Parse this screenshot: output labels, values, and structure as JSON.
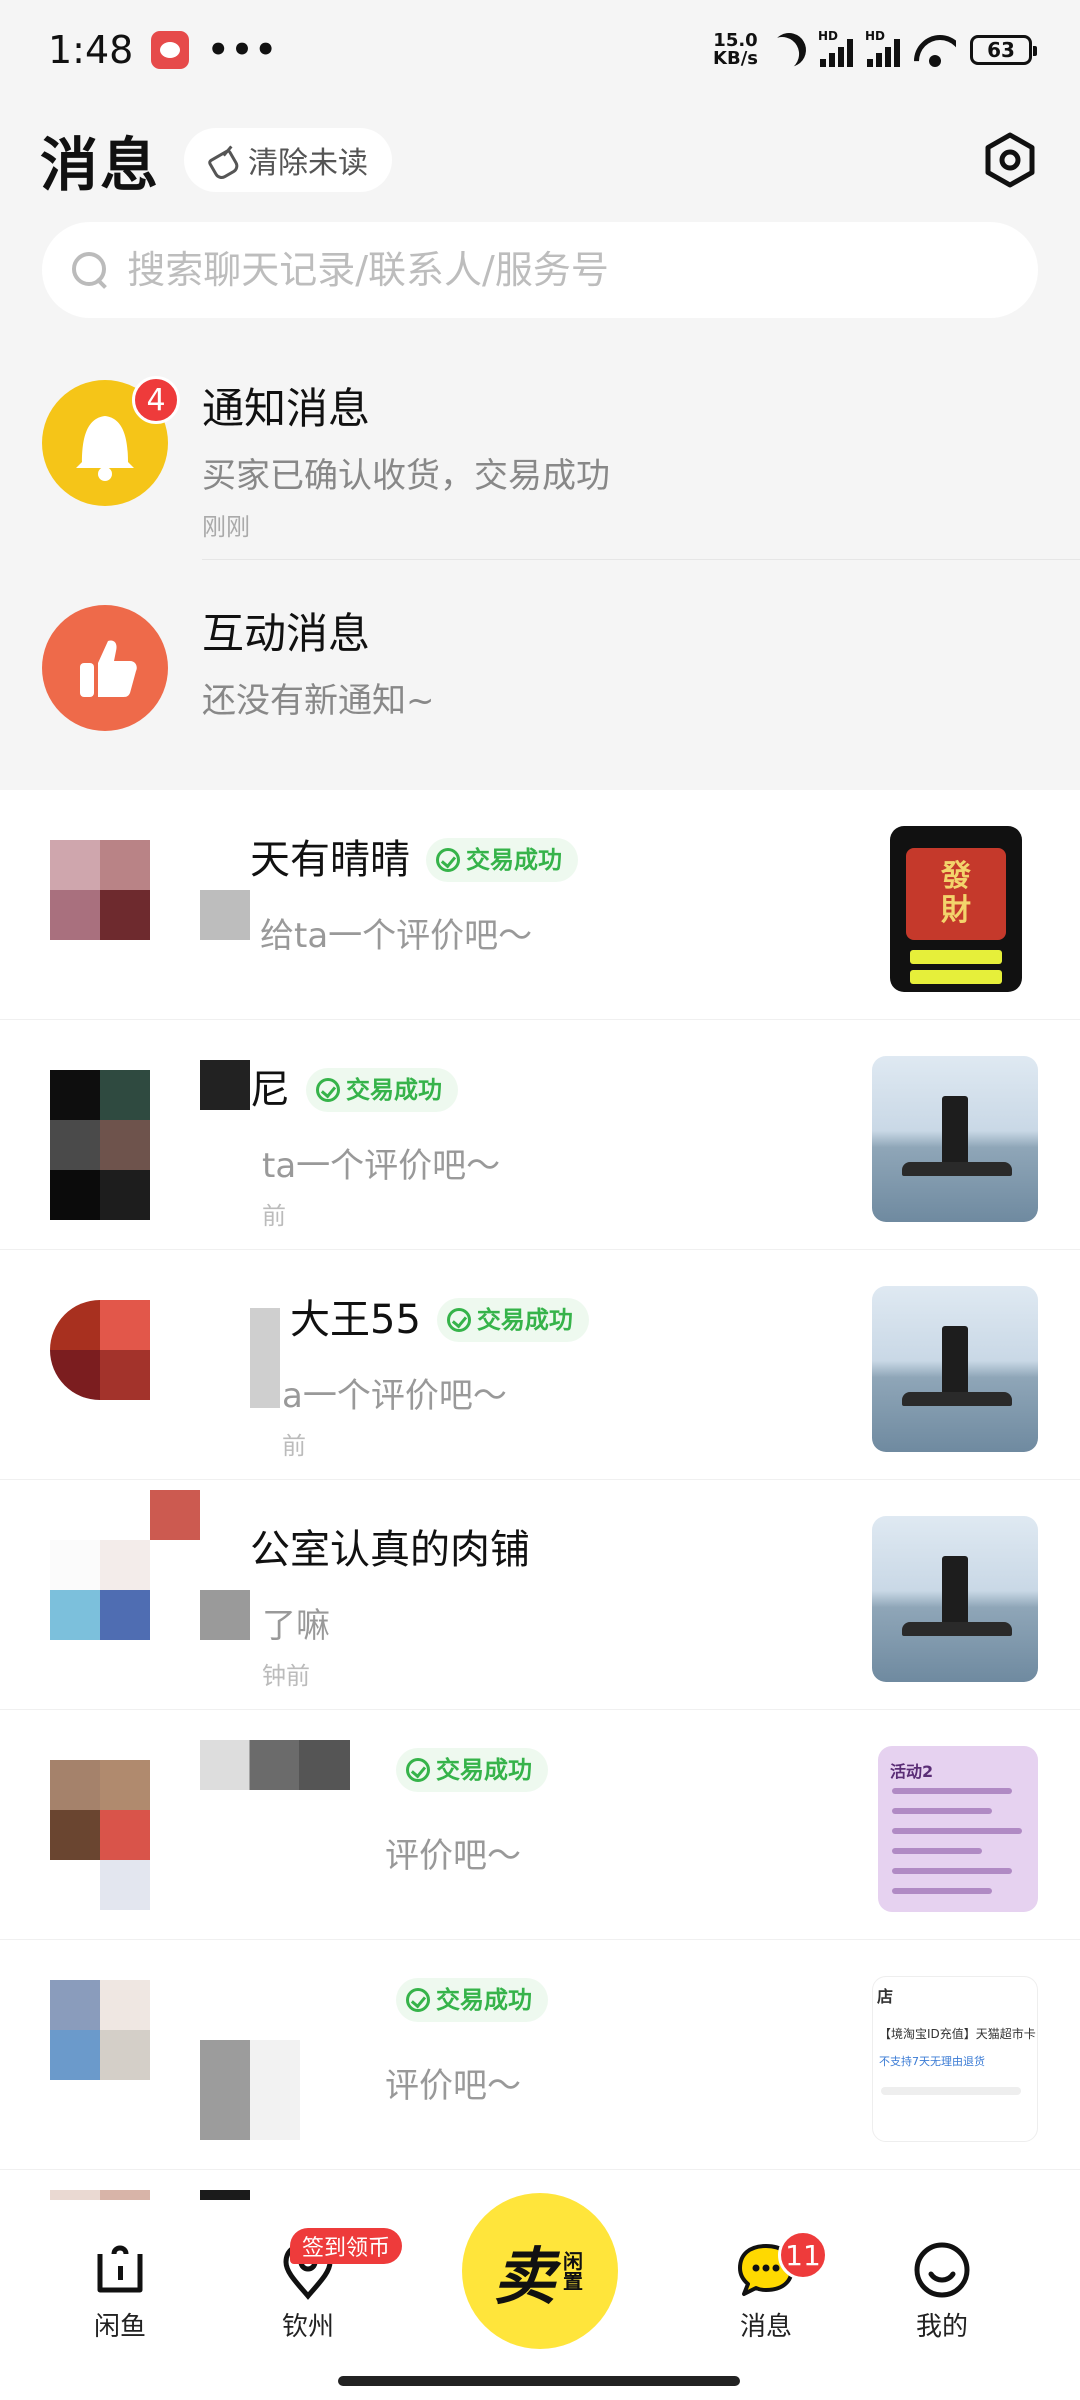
{
  "status_bar": {
    "time": "1:48",
    "dots": "•••",
    "net_speed_value": "15.0",
    "net_speed_unit": "KB/s",
    "hd1": "HD",
    "hd2": "HD",
    "battery": "63"
  },
  "header": {
    "title": "消息",
    "clear_unread": "清除未读"
  },
  "search": {
    "placeholder": "搜索聊天记录/联系人/服务号"
  },
  "system_messages": [
    {
      "title": "通知消息",
      "subtitle": "买家已确认收货，交易成功",
      "time": "刚刚",
      "badge": "4",
      "color": "#f5c518"
    },
    {
      "title": "互动消息",
      "subtitle": "还没有新通知~",
      "color": "#ee6a4a"
    }
  ],
  "chats": [
    {
      "name": "天有晴晴",
      "badge": "交易成功",
      "preview": "给ta一个评价吧～",
      "time": ""
    },
    {
      "name": "尼",
      "badge": "交易成功",
      "preview": "ta一个评价吧～",
      "time": "前"
    },
    {
      "name": "大王55",
      "badge": "交易成功",
      "preview": "a一个评价吧～",
      "time": "前"
    },
    {
      "name": "公室认真的肉铺",
      "badge": "",
      "preview": "了嘛",
      "time": "钟前"
    },
    {
      "name": "",
      "badge": "交易成功",
      "preview": "评价吧～",
      "time": ""
    },
    {
      "name": "",
      "badge": "交易成功",
      "preview": "评价吧～",
      "time": ""
    }
  ],
  "thumbnails": {
    "fortune_text_top": "發",
    "fortune_text_bottom": "財",
    "purple_title": "活动2",
    "shop_label": "店",
    "shop_item": "【境淘宝ID充值】天猫超市卡",
    "shop_sub": "不支持7天无理由退货"
  },
  "bottom_nav": {
    "home": "闲鱼",
    "location": "钦州",
    "checkin_badge": "签到领币",
    "sell_main": "卖",
    "sell_sub": "闲置",
    "messages": "消息",
    "messages_badge": "11",
    "me": "我的"
  }
}
